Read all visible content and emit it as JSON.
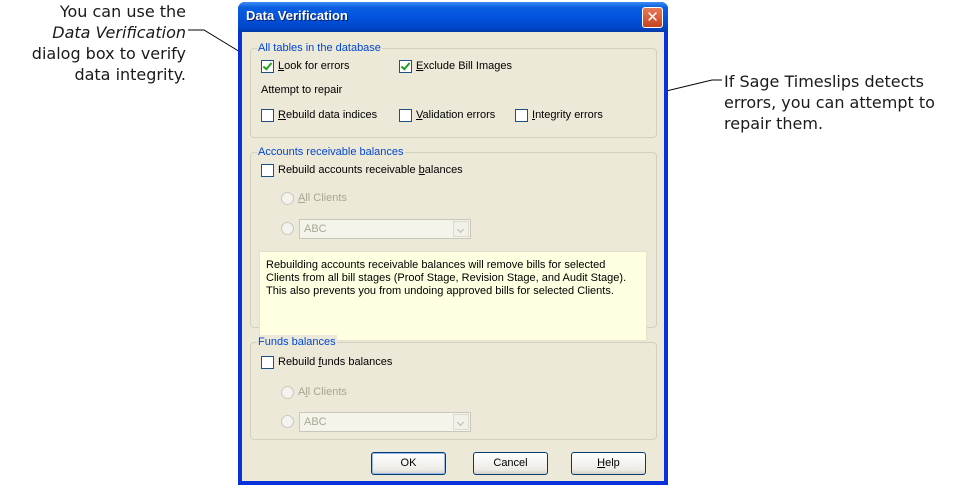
{
  "callouts": {
    "left_prefix": "You can use the",
    "left_emph": "Data Verification",
    "left_suffix_1": "dialog box to verify",
    "left_suffix_2": "data integrity.",
    "right_line_1": "If Sage Timeslips detects",
    "right_line_2": "errors, you can attempt to",
    "right_line_3": "repair them."
  },
  "dialog": {
    "title": "Data Verification",
    "close_glyph": "✕",
    "group_tables": {
      "legend": "All tables in the database",
      "look_for_errors": {
        "pre": "",
        "key": "L",
        "post": "ook for errors",
        "checked": true
      },
      "exclude_bill_images": {
        "pre": "",
        "key": "E",
        "post": "xclude Bill Images",
        "checked": true
      },
      "attempt_label": "Attempt to repair",
      "rebuild_indices": {
        "pre": "",
        "key": "R",
        "post": "ebuild data indices",
        "checked": false
      },
      "validation_errors": {
        "pre": "",
        "key": "V",
        "post": "alidation errors",
        "checked": false
      },
      "integrity_errors": {
        "pre": "",
        "key": "I",
        "post": "ntegrity errors",
        "checked": false
      }
    },
    "group_ar": {
      "legend": "Accounts receivable balances",
      "rebuild": {
        "pre": "Rebuild accounts receivable ",
        "key": "b",
        "post": "alances",
        "checked": false
      },
      "all_clients": {
        "pre": "",
        "key": "A",
        "post": "ll Clients"
      },
      "client_select": "ABC",
      "note": "Rebuilding accounts receivable balances will remove bills for selected Clients from all bill stages (Proof Stage, Revision Stage, and Audit Stage). This also prevents you from undoing approved bills for selected Clients."
    },
    "group_funds": {
      "legend": "Funds balances",
      "rebuild": {
        "pre": "Rebuild ",
        "key": "f",
        "post": "unds balances",
        "checked": false
      },
      "all_clients": {
        "pre": "A",
        "key": "l",
        "post": "l Clients"
      },
      "client_select": "ABC"
    },
    "buttons": {
      "ok": "OK",
      "cancel": "Cancel",
      "help": {
        "pre": "",
        "key": "H",
        "post": "elp"
      }
    }
  }
}
